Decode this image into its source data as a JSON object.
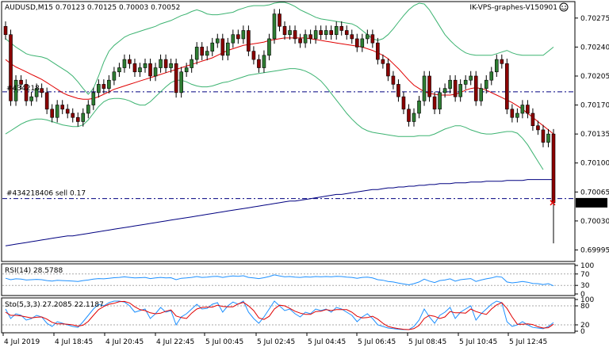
{
  "header": {
    "symbol_info": "AUDUSD,M15  0.70123 0.70125 0.70003 0.70052",
    "account": "IK-VPS-graphes-V150901"
  },
  "current_price": "0.70052",
  "colors": {
    "bull": "#2e7d32",
    "bear": "#8b0000",
    "bands": "#3cb371",
    "ma": "#e00000",
    "long_ma": "#000080",
    "rsi": "#1e90ff",
    "stoch_main": "#1e90ff",
    "stoch_signal": "#e00000",
    "price_tag_bg": "#000000"
  },
  "chart_data": [
    {
      "type": "candlestick",
      "title": "AUDUSD,M15",
      "ohlc_header": [
        "0.70123",
        "0.70125",
        "0.70003",
        "0.70052"
      ],
      "ylim": [
        0.69983,
        0.70293
      ],
      "y_ticks": [
        "0.70275",
        "0.70240",
        "0.70205",
        "0.70170",
        "0.70135",
        "0.70100",
        "0.70065",
        "0.70030",
        "0.69995"
      ],
      "x_ticks": [
        "4 Jul 2019",
        "4 Jul 18:45",
        "4 Jul 20:45",
        "4 Jul 22:45",
        "5 Jul 00:45",
        "5 Jul 02:45",
        "5 Jul 04:45",
        "5 Jul 06:45",
        "5 Jul 08:45",
        "5 Jul 10:45",
        "5 Jul 12:45"
      ],
      "close": [
        0.70255,
        0.70175,
        0.702,
        0.70195,
        0.70175,
        0.7018,
        0.7019,
        0.70185,
        0.70165,
        0.70155,
        0.7017,
        0.70165,
        0.7016,
        0.70155,
        0.7015,
        0.7016,
        0.7017,
        0.70185,
        0.70195,
        0.7019,
        0.702,
        0.7021,
        0.70215,
        0.70225,
        0.7022,
        0.7021,
        0.70215,
        0.7022,
        0.70205,
        0.70215,
        0.70225,
        0.70215,
        0.7022,
        0.70185,
        0.7021,
        0.70215,
        0.70225,
        0.7024,
        0.7023,
        0.70235,
        0.70245,
        0.7025,
        0.7023,
        0.70245,
        0.70255,
        0.7025,
        0.7026,
        0.70235,
        0.70225,
        0.70215,
        0.7023,
        0.7025,
        0.7028,
        0.70265,
        0.70255,
        0.7026,
        0.7025,
        0.70245,
        0.70255,
        0.7025,
        0.7026,
        0.70255,
        0.7026,
        0.70255,
        0.70265,
        0.7026,
        0.70255,
        0.7025,
        0.7024,
        0.7025,
        0.70255,
        0.70245,
        0.70225,
        0.7022,
        0.70205,
        0.70195,
        0.7018,
        0.70165,
        0.7015,
        0.7016,
        0.70175,
        0.70205,
        0.7018,
        0.70165,
        0.70185,
        0.7019,
        0.702,
        0.7018,
        0.70195,
        0.702,
        0.70205,
        0.70175,
        0.7019,
        0.702,
        0.7021,
        0.70225,
        0.7022,
        0.70165,
        0.70155,
        0.7016,
        0.7017,
        0.7016,
        0.70145,
        0.7014,
        0.70125,
        0.70135,
        0.70052
      ],
      "series": [
        {
          "name": "",
          "kind": "bollinger_upper",
          "values": [
            0.7025,
            0.70245,
            0.7024,
            0.70236,
            0.70232,
            0.7023,
            0.70229,
            0.70228,
            0.70226,
            0.70222,
            0.70218,
            0.70214,
            0.7021,
            0.70205,
            0.70198,
            0.7019,
            0.70183,
            0.7019,
            0.70205,
            0.70222,
            0.70235,
            0.70242,
            0.70247,
            0.70252,
            0.70255,
            0.70257,
            0.70259,
            0.70261,
            0.70263,
            0.70265,
            0.70268,
            0.7027,
            0.70272,
            0.70275,
            0.70278,
            0.7028,
            0.70283,
            0.70285,
            0.70283,
            0.7028,
            0.70279,
            0.70279,
            0.7028,
            0.70281,
            0.70282,
            0.70285,
            0.70287,
            0.70289,
            0.7029,
            0.7029,
            0.7029,
            0.70291,
            0.70293,
            0.70294,
            0.70294,
            0.70292,
            0.70289,
            0.70285,
            0.70282,
            0.70279,
            0.70276,
            0.70274,
            0.70273,
            0.70272,
            0.70271,
            0.7027,
            0.70269,
            0.70268,
            0.70265,
            0.7026,
            0.70255,
            0.7025,
            0.70248,
            0.7025,
            0.70255,
            0.70262,
            0.7027,
            0.70278,
            0.70285,
            0.7029,
            0.70293,
            0.70292,
            0.70285,
            0.70275,
            0.70265,
            0.70255,
            0.70248,
            0.70242,
            0.70237,
            0.70233,
            0.70231,
            0.7023,
            0.7023,
            0.7023,
            0.7023,
            0.70232,
            0.70234,
            0.70236,
            0.70233,
            0.70231,
            0.7023,
            0.7023,
            0.7023,
            0.7023,
            0.7023,
            0.70235,
            0.7024
          ]
        },
        {
          "name": "",
          "kind": "bollinger_lower",
          "values": [
            0.70135,
            0.70139,
            0.70143,
            0.70147,
            0.7015,
            0.70152,
            0.70153,
            0.70153,
            0.70152,
            0.7015,
            0.70148,
            0.70146,
            0.70145,
            0.70144,
            0.70144,
            0.70146,
            0.70152,
            0.7016,
            0.70168,
            0.70174,
            0.70177,
            0.70178,
            0.70178,
            0.70177,
            0.70175,
            0.70172,
            0.7017,
            0.7017,
            0.70174,
            0.7018,
            0.70186,
            0.70192,
            0.70197,
            0.702,
            0.702,
            0.70198,
            0.70195,
            0.70193,
            0.70192,
            0.70192,
            0.70193,
            0.70195,
            0.70197,
            0.70198,
            0.702,
            0.70202,
            0.70204,
            0.70206,
            0.70207,
            0.70208,
            0.70209,
            0.7021,
            0.70211,
            0.70212,
            0.70213,
            0.70214,
            0.70214,
            0.70213,
            0.70211,
            0.70208,
            0.70204,
            0.70199,
            0.70192,
            0.70184,
            0.70176,
            0.70168,
            0.7016,
            0.70153,
            0.70147,
            0.70142,
            0.70139,
            0.70137,
            0.70136,
            0.70135,
            0.70134,
            0.70133,
            0.70132,
            0.70132,
            0.70132,
            0.70132,
            0.70133,
            0.70133,
            0.70133,
            0.70135,
            0.70138,
            0.70141,
            0.70143,
            0.70145,
            0.70145,
            0.70143,
            0.7014,
            0.70138,
            0.70136,
            0.70135,
            0.70135,
            0.70136,
            0.70137,
            0.70138,
            0.70138,
            0.70136,
            0.7013,
            0.70122,
            0.70112,
            0.70102,
            0.70092
          ]
        },
        {
          "name": "",
          "kind": "moving_average",
          "values": [
            0.70225,
            0.7022,
            0.70216,
            0.70213,
            0.7021,
            0.70207,
            0.70204,
            0.70201,
            0.70197,
            0.70193,
            0.70189,
            0.70185,
            0.70182,
            0.7018,
            0.70178,
            0.70177,
            0.70177,
            0.70178,
            0.7018,
            0.70183,
            0.70186,
            0.70189,
            0.70191,
            0.70193,
            0.70195,
            0.70197,
            0.70199,
            0.70201,
            0.70203,
            0.70205,
            0.70207,
            0.70209,
            0.70211,
            0.70213,
            0.70215,
            0.70217,
            0.70219,
            0.70221,
            0.70223,
            0.70225,
            0.70227,
            0.7023,
            0.70233,
            0.70236,
            0.70238,
            0.7024,
            0.70242,
            0.70243,
            0.70244,
            0.70245,
            0.70246,
            0.70248,
            0.70249,
            0.7025,
            0.70251,
            0.70251,
            0.70251,
            0.70251,
            0.70251,
            0.7025,
            0.70249,
            0.70248,
            0.70247,
            0.70246,
            0.70245,
            0.70244,
            0.70243,
            0.70242,
            0.70241,
            0.7024,
            0.70238,
            0.70236,
            0.70233,
            0.7023,
            0.70226,
            0.7022,
            0.70214,
            0.70207,
            0.702,
            0.70194,
            0.7019,
            0.70186,
            0.70184,
            0.70183,
            0.70182,
            0.70182,
            0.70182,
            0.70183,
            0.70185,
            0.70188,
            0.7019,
            0.70191,
            0.7019,
            0.70188,
            0.70185,
            0.70182,
            0.70179,
            0.70176,
            0.70173,
            0.70169,
            0.70165,
            0.7016,
            0.70155,
            0.7015,
            0.70145,
            0.7014,
            0.70135
          ]
        },
        {
          "name": "",
          "kind": "long_moving_average",
          "values": [
            0.7,
            0.70001,
            0.70002,
            0.70003,
            0.70004,
            0.70005,
            0.70006,
            0.70007,
            0.70008,
            0.70009,
            0.7001,
            0.70011,
            0.70012,
            0.70012,
            0.70013,
            0.70014,
            0.70015,
            0.70016,
            0.70017,
            0.70018,
            0.70019,
            0.7002,
            0.70021,
            0.70022,
            0.70023,
            0.70024,
            0.70025,
            0.70026,
            0.70027,
            0.70028,
            0.70029,
            0.7003,
            0.70031,
            0.70032,
            0.70033,
            0.70034,
            0.70035,
            0.70036,
            0.70037,
            0.70038,
            0.70039,
            0.7004,
            0.70041,
            0.70042,
            0.70043,
            0.70044,
            0.70045,
            0.70046,
            0.70047,
            0.70048,
            0.70049,
            0.7005,
            0.70051,
            0.70052,
            0.70053,
            0.70054,
            0.70054,
            0.70055,
            0.70056,
            0.70057,
            0.70058,
            0.70059,
            0.7006,
            0.70061,
            0.70062,
            0.70062,
            0.70063,
            0.70064,
            0.70065,
            0.70066,
            0.70067,
            0.70068,
            0.70068,
            0.70069,
            0.7007,
            0.7007,
            0.70071,
            0.70071,
            0.70072,
            0.70072,
            0.70073,
            0.70073,
            0.70074,
            0.70074,
            0.70075,
            0.70075,
            0.70075,
            0.70076,
            0.70076,
            0.70076,
            0.70077,
            0.70077,
            0.70077,
            0.70078,
            0.70078,
            0.70078,
            0.70078,
            0.70079,
            0.70079,
            0.70079,
            0.70079,
            0.7008,
            0.7008,
            0.7008,
            0.7008,
            0.7008,
            0.7008
          ]
        }
      ],
      "levels": [
        {
          "label": "#434218406 sell 0.17",
          "price": 0.70057
        },
        {
          "label": "#434218",
          "price": 0.70186
        }
      ]
    },
    {
      "type": "line",
      "title": "RSI(14) 28.5788",
      "ylim": [
        0,
        100
      ],
      "y_ticks": [
        "100",
        "70",
        "30",
        "0"
      ],
      "series": [
        {
          "name": "RSI(14)",
          "values": [
            55,
            50,
            53,
            52,
            49,
            50,
            51,
            50,
            47,
            45,
            48,
            47,
            46,
            45,
            44,
            47,
            49,
            52,
            54,
            53,
            55,
            57,
            58,
            60,
            58,
            56,
            57,
            58,
            54,
            56,
            58,
            56,
            57,
            50,
            55,
            56,
            58,
            61,
            58,
            59,
            61,
            62,
            58,
            61,
            63,
            62,
            64,
            58,
            56,
            54,
            57,
            61,
            67,
            63,
            60,
            61,
            59,
            58,
            60,
            59,
            61,
            60,
            61,
            60,
            62,
            61,
            59,
            58,
            55,
            58,
            59,
            56,
            50,
            48,
            44,
            42,
            38,
            35,
            32,
            36,
            42,
            52,
            45,
            40,
            47,
            49,
            53,
            45,
            50,
            52,
            54,
            44,
            49,
            53,
            56,
            61,
            59,
            42,
            39,
            41,
            44,
            41,
            37,
            36,
            33,
            36,
            28.5788
          ]
        }
      ]
    },
    {
      "type": "line",
      "title": "Sto(5,3,3) 27.2085 22.1187",
      "ylim": [
        0,
        100
      ],
      "y_ticks": [
        "100",
        "80",
        "20",
        "0"
      ],
      "series": [
        {
          "name": "main",
          "values": [
            70,
            40,
            55,
            50,
            35,
            40,
            50,
            45,
            25,
            15,
            30,
            25,
            20,
            15,
            12,
            30,
            50,
            70,
            85,
            80,
            90,
            95,
            95,
            92,
            80,
            60,
            65,
            70,
            40,
            55,
            75,
            60,
            65,
            20,
            45,
            55,
            70,
            85,
            70,
            72,
            85,
            90,
            60,
            80,
            92,
            85,
            95,
            60,
            40,
            25,
            45,
            70,
            95,
            80,
            65,
            70,
            55,
            45,
            60,
            55,
            70,
            65,
            70,
            60,
            75,
            70,
            60,
            50,
            30,
            45,
            55,
            40,
            20,
            15,
            10,
            8,
            6,
            5,
            5,
            15,
            35,
            70,
            45,
            25,
            50,
            60,
            75,
            40,
            60,
            70,
            80,
            35,
            55,
            70,
            85,
            95,
            90,
            30,
            15,
            20,
            30,
            20,
            12,
            10,
            8,
            15,
            27.2085
          ]
        },
        {
          "name": "signal",
          "values": [
            60,
            50,
            50,
            48,
            45,
            42,
            44,
            45,
            38,
            28,
            23,
            23,
            22,
            20,
            16,
            19,
            31,
            50,
            68,
            78,
            85,
            88,
            93,
            94,
            89,
            77,
            68,
            65,
            58,
            55,
            57,
            63,
            67,
            48,
            43,
            40,
            57,
            70,
            75,
            76,
            76,
            82,
            78,
            77,
            77,
            86,
            91,
            80,
            65,
            42,
            37,
            47,
            70,
            82,
            80,
            72,
            63,
            57,
            53,
            53,
            62,
            63,
            68,
            65,
            68,
            68,
            68,
            60,
            47,
            42,
            43,
            47,
            38,
            25,
            15,
            11,
            8,
            6,
            5,
            8,
            18,
            40,
            50,
            47,
            40,
            45,
            62,
            58,
            58,
            57,
            70,
            62,
            57,
            53,
            70,
            83,
            90,
            72,
            45,
            22,
            22,
            23,
            21,
            14,
            10,
            11,
            22.1187
          ]
        }
      ]
    }
  ]
}
